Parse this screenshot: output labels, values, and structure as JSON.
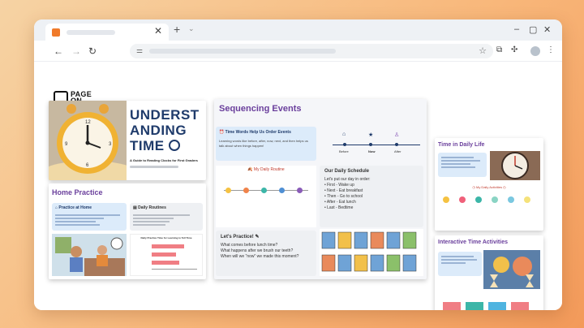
{
  "logo": {
    "line1": "PAGE",
    "line2": "ON"
  },
  "cover": {
    "title_line1": "UNDERST",
    "title_line2": "ANDING",
    "title_line3": "TIME",
    "subtitle": "A Guide to Reading Clocks for First Graders"
  },
  "home_practice": {
    "title": "Home Practice",
    "practice_box_title": "Practice at Home",
    "routines_box_title": "Daily Routines",
    "chart_title": "Daily Practice Time for Learning to Tell Time"
  },
  "sequencing": {
    "title": "Sequencing Events",
    "time_words_title": "Time Words Help Us Order Events",
    "time_words_body": "Learning words like before, after, now, next, and then helps us talk about when things happen!",
    "timeline_labels": [
      "Before",
      "Now",
      "After"
    ],
    "routine_title": "My Daily Routine",
    "schedule_title": "Our Daily Schedule",
    "schedule_intro": "Let's put our day in order:",
    "schedule_items": [
      "First - Wake up",
      "Next - Eat breakfast",
      "Then - Go to school",
      "After - Eat lunch",
      "Last - Bedtime"
    ],
    "practice_title": "Let's Practice!",
    "practice_questions": [
      "What comes before lunch time?",
      "What happens after we brush our teeth?",
      "When will we \"now\" we made this moment?"
    ]
  },
  "daily_life": {
    "title": "Time in Daily Life",
    "activities_label": "My Daily Activities"
  },
  "interactive": {
    "title": "Interactive Time Activities"
  },
  "colors": {
    "accent_purple": "#6a3f9c",
    "title_navy": "#1f3b6b",
    "box_blue": "#dcebfa",
    "bar_teal": "#f07e84",
    "page_bg_orange": "#f8b77a"
  }
}
